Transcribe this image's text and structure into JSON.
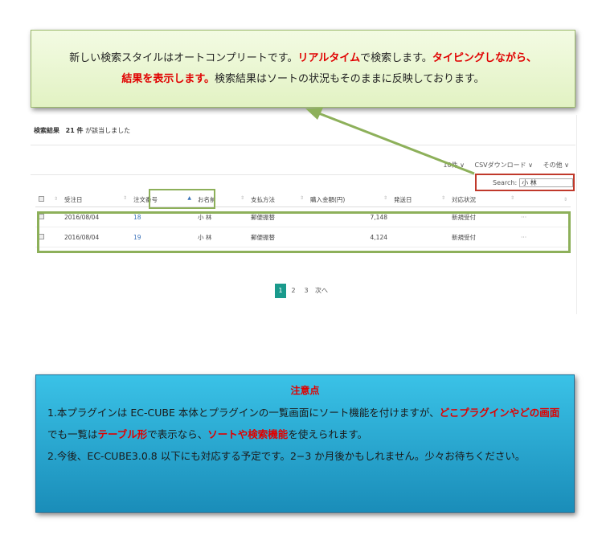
{
  "callout_top": {
    "seg1": "新しい検索スタイルはオートコンプリートです。",
    "seg2": "リアルタイム",
    "seg3": "で検索します。",
    "seg4": "タイピングしながら、",
    "seg5": "結果を表示します。",
    "seg6": "検索結果はソートの状況もそのままに反映しております。"
  },
  "result_header": {
    "label": "検索結果",
    "count": "21 件",
    "suffix": "が該当しました"
  },
  "toolbar": {
    "per_page": "10件 ∨",
    "csv": "CSVダウンロード ∨",
    "other": "その他 ∨"
  },
  "search": {
    "label": "Search:",
    "value": "小 林"
  },
  "table": {
    "headers": [
      "受注日",
      "注文番号",
      "お名前",
      "支払方法",
      "購入金額(円)",
      "発送日",
      "対応状況"
    ],
    "rows": [
      {
        "date": "2016/08/04",
        "order": "18",
        "name": "小 林",
        "payment": "郵便振替",
        "amount": "7,148",
        "ship": "",
        "status": "新規受付",
        "more": "···"
      },
      {
        "date": "2016/08/04",
        "order": "19",
        "name": "小 林",
        "payment": "郵便振替",
        "amount": "4,124",
        "ship": "",
        "status": "新規受付",
        "more": "···"
      }
    ]
  },
  "pager": {
    "p1": "1",
    "p2": "2",
    "p3": "3",
    "next": "次へ"
  },
  "note": {
    "title": "注意点",
    "l1a": "1.本プラグインは EC-CUBE 本体とプラグインの一覧画面にソート機能を付けますが、",
    "l1b": "どこプラグインやどの画面",
    "l1c": "でも一覧は",
    "l1d": "テーブル形",
    "l1e": "で表示なら、",
    "l1f": "ソートや検索機能",
    "l1g": "を使えられます。",
    "l2": "2.今後、EC-CUBE3.0.8 以下にも対応する予定です。2−3 か月後かもしれません。少々お待ちください。"
  },
  "colors": {
    "callout_bg": "#e8f5d0",
    "highlight_green": "#8db05a",
    "search_highlight": "#c0392b",
    "note_bg": "#2aa9d6",
    "accent_red": "#e00000"
  }
}
